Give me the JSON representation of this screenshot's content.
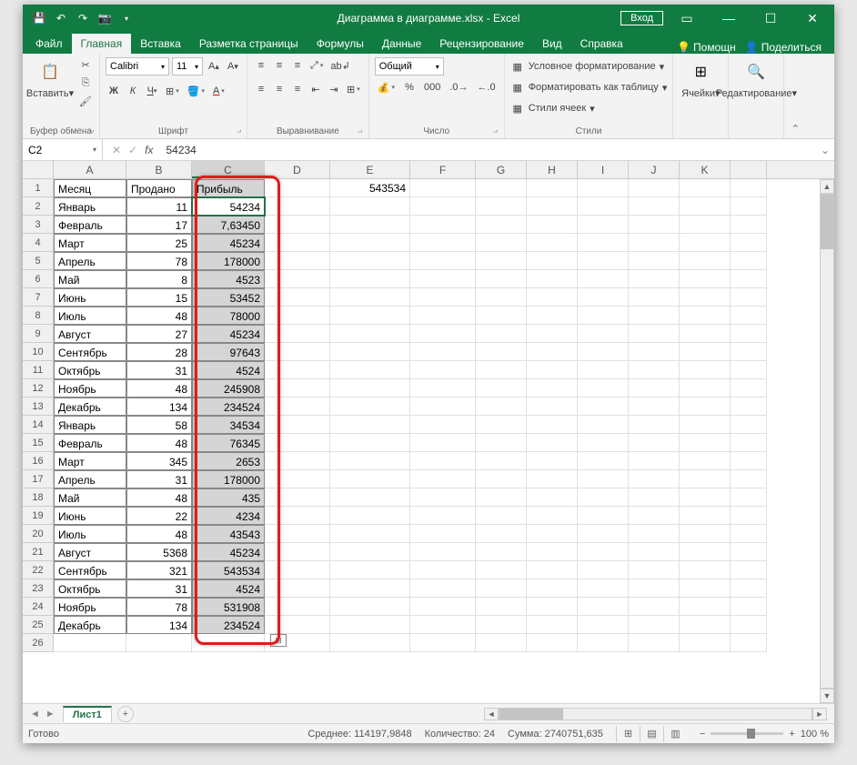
{
  "title": "Диаграмма в диаграмме.xlsx  -  Excel",
  "login": "Вход",
  "tabs": {
    "file": "Файл",
    "home": "Главная",
    "insert": "Вставка",
    "pagelayout": "Разметка страницы",
    "formulas": "Формулы",
    "data": "Данные",
    "review": "Рецензирование",
    "view": "Вид",
    "help": "Справка"
  },
  "rightTabs": {
    "help": "Помощн",
    "share": "Поделиться"
  },
  "ribbon": {
    "paste": "Вставить",
    "clipboard": "Буфер обмена",
    "font_name": "Calibri",
    "font_size": "11",
    "font": "Шрифт",
    "alignment": "Выравнивание",
    "number_format": "Общий",
    "number": "Число",
    "cond": "Условное форматирование",
    "table": "Форматировать как таблицу",
    "cellstyles": "Стили ячеек",
    "styles": "Стили",
    "cells": "Ячейки",
    "editing": "Редактирование"
  },
  "namebox": "C2",
  "formula": "54234",
  "cols": [
    "A",
    "B",
    "C",
    "D",
    "E",
    "F",
    "G",
    "H",
    "I",
    "J",
    "K"
  ],
  "headers": {
    "A": "Месяц",
    "B": "Продано",
    "C": "Прибыль"
  },
  "e1": "543534",
  "data_rows": [
    {
      "m": "Январь",
      "s": "11",
      "p": "54234"
    },
    {
      "m": "Февраль",
      "s": "17",
      "p": "7,63450"
    },
    {
      "m": "Март",
      "s": "25",
      "p": "45234"
    },
    {
      "m": "Апрель",
      "s": "78",
      "p": "178000"
    },
    {
      "m": "Май",
      "s": "8",
      "p": "4523"
    },
    {
      "m": "Июнь",
      "s": "15",
      "p": "53452"
    },
    {
      "m": "Июль",
      "s": "48",
      "p": "78000"
    },
    {
      "m": "Август",
      "s": "27",
      "p": "45234"
    },
    {
      "m": "Сентябрь",
      "s": "28",
      "p": "97643"
    },
    {
      "m": "Октябрь",
      "s": "31",
      "p": "4524"
    },
    {
      "m": "Ноябрь",
      "s": "48",
      "p": "245908"
    },
    {
      "m": "Декабрь",
      "s": "134",
      "p": "234524"
    },
    {
      "m": "Январь",
      "s": "58",
      "p": "34534"
    },
    {
      "m": "Февраль",
      "s": "48",
      "p": "76345"
    },
    {
      "m": "Март",
      "s": "345",
      "p": "2653"
    },
    {
      "m": "Апрель",
      "s": "31",
      "p": "178000"
    },
    {
      "m": "Май",
      "s": "48",
      "p": "435"
    },
    {
      "m": "Июнь",
      "s": "22",
      "p": "4234"
    },
    {
      "m": "Июль",
      "s": "48",
      "p": "43543"
    },
    {
      "m": "Август",
      "s": "5368",
      "p": "45234"
    },
    {
      "m": "Сентябрь",
      "s": "321",
      "p": "543534"
    },
    {
      "m": "Октябрь",
      "s": "31",
      "p": "4524"
    },
    {
      "m": "Ноябрь",
      "s": "78",
      "p": "531908"
    },
    {
      "m": "Декабрь",
      "s": "134",
      "p": "234524"
    }
  ],
  "sheet": "Лист1",
  "status": {
    "ready": "Готово",
    "avg": "Среднее: 114197,9848",
    "count": "Количество: 24",
    "sum": "Сумма: 2740751,635",
    "zoom": "100 %"
  }
}
